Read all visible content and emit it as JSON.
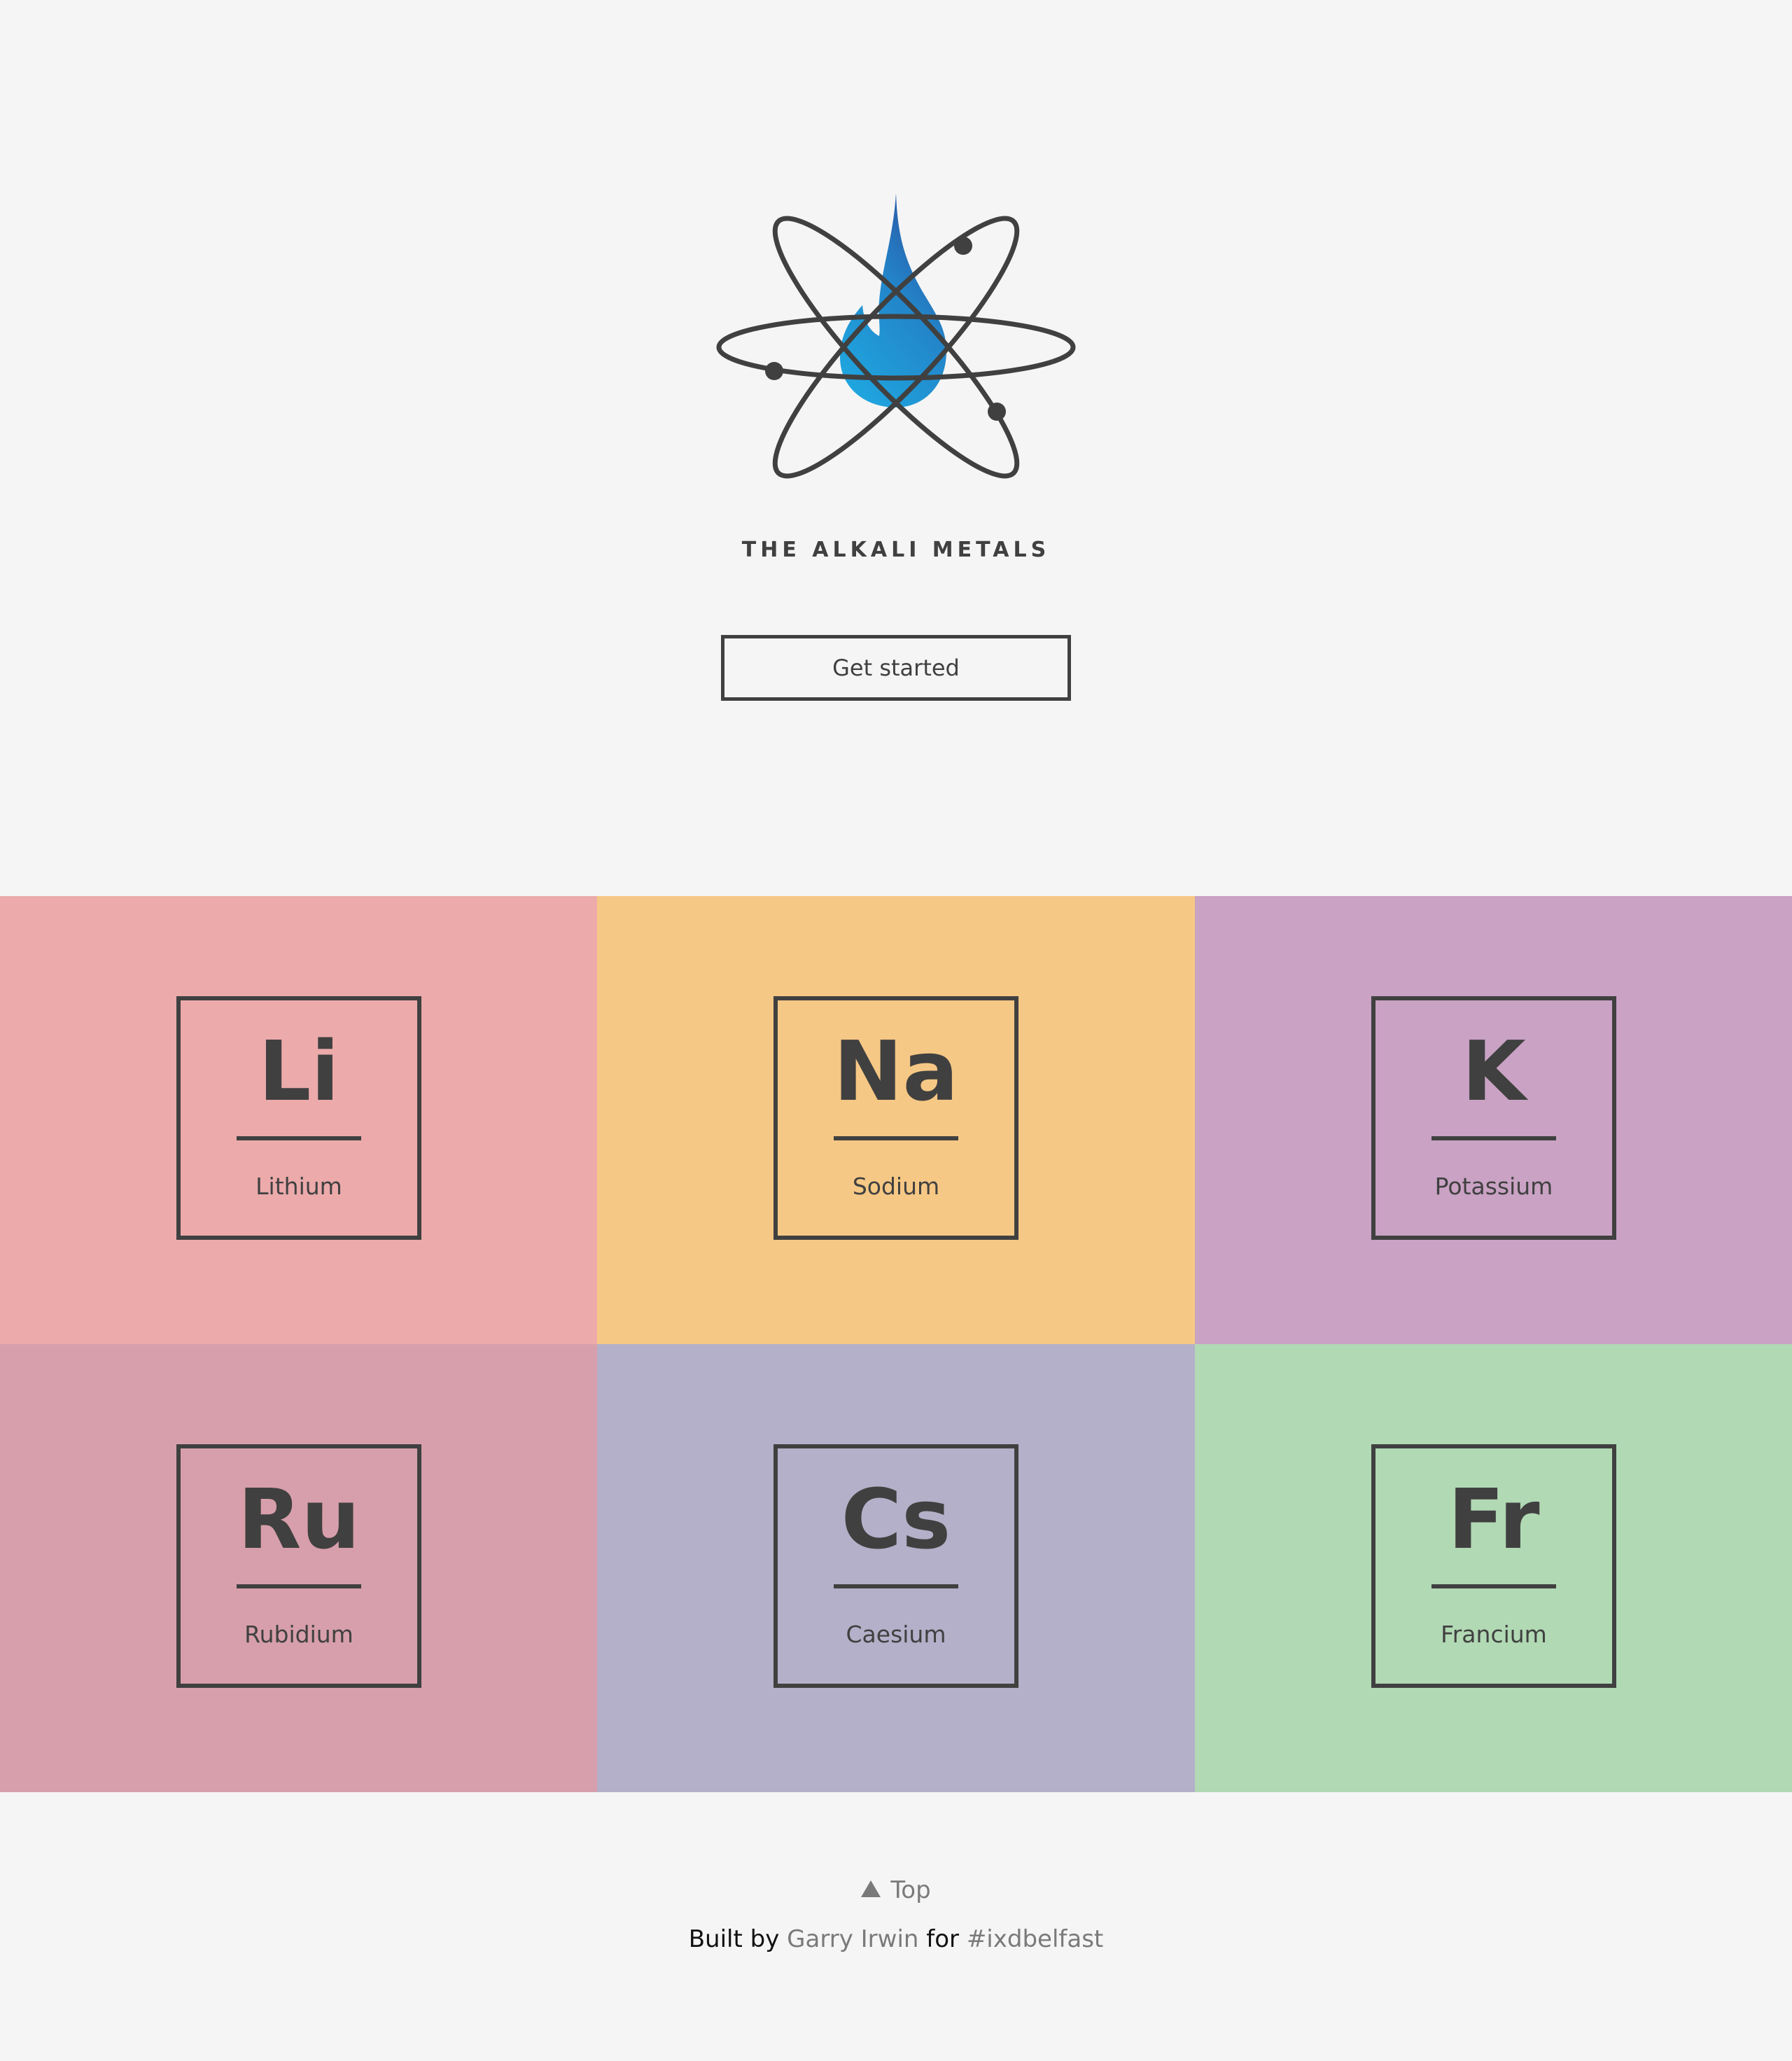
{
  "header": {
    "title": "THE ALKALI METALS",
    "cta_label": "Get started"
  },
  "elements": [
    {
      "symbol": "Li",
      "name": "Lithium",
      "color": "#ecaaab"
    },
    {
      "symbol": "Na",
      "name": "Sodium",
      "color": "#f6c885"
    },
    {
      "symbol": "K",
      "name": "Potassium",
      "color": "#c9a2c4"
    },
    {
      "symbol": "Ru",
      "name": "Rubidium",
      "color": "#d79fab"
    },
    {
      "symbol": "Cs",
      "name": "Caesium",
      "color": "#b4b0c9"
    },
    {
      "symbol": "Fr",
      "name": "Francium",
      "color": "#b1d9b4"
    }
  ],
  "footer": {
    "top_label": "Top",
    "built_by": "Built by",
    "author": "Garry Irwin",
    "for_text": "for",
    "hashtag": "#ixdbelfast"
  },
  "colors": {
    "background": "#f5f5f5",
    "ink": "#404040",
    "flame_light": "#1fa7e0",
    "flame_dark": "#2a4fa0",
    "muted_link": "#7a7a7a"
  },
  "icons": {
    "logo": "atom-flame-icon",
    "top": "triangle-up-icon"
  }
}
